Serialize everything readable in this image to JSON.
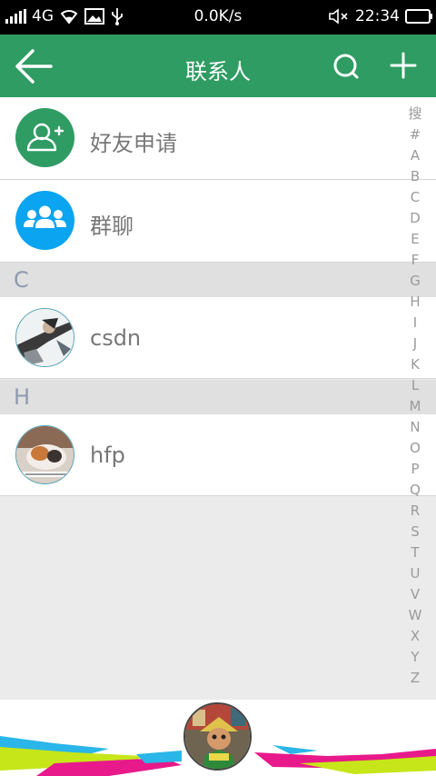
{
  "status_bar": {
    "network": "4G",
    "speed": "0.0K/s",
    "time": "22:34"
  },
  "header": {
    "title": "联系人"
  },
  "fixed_items": [
    {
      "label": "好友申请",
      "icon": "add-user-icon",
      "color": "#2f9c63"
    },
    {
      "label": "群聊",
      "icon": "group-icon",
      "color": "#0ba4f0"
    }
  ],
  "sections": [
    {
      "letter": "C",
      "contacts": [
        {
          "name": "csdn"
        }
      ]
    },
    {
      "letter": "H",
      "contacts": [
        {
          "name": "hfp"
        }
      ]
    }
  ],
  "index_letters": [
    "搜",
    "#",
    "A",
    "B",
    "C",
    "D",
    "E",
    "F",
    "G",
    "H",
    "I",
    "J",
    "K",
    "L",
    "M",
    "N",
    "O",
    "P",
    "Q",
    "R",
    "S",
    "T",
    "U",
    "V",
    "W",
    "X",
    "Y",
    "Z"
  ],
  "colors": {
    "accent": "#2f9c63",
    "group_blue": "#0ba4f0",
    "section_bg": "#e0e0e0",
    "list_bg": "#ebebeb"
  }
}
